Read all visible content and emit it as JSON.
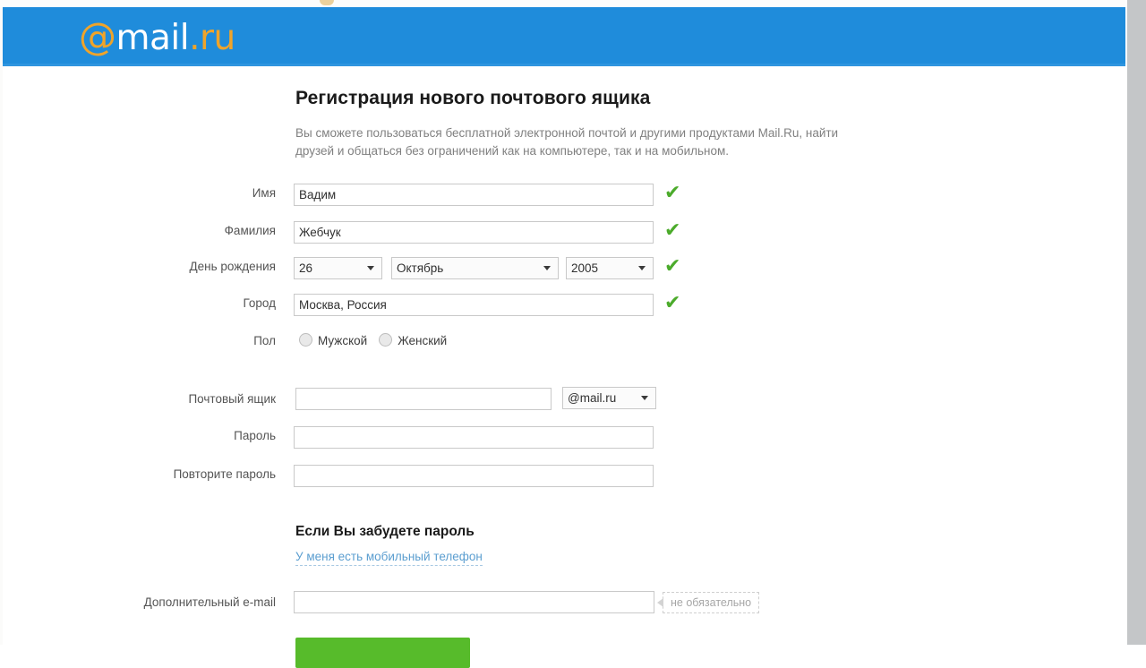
{
  "brand": {
    "at": "@",
    "mail": "mail",
    "dotru": ".ru",
    "header_color": "#1f8cdb",
    "accent_orange": "#efa42a",
    "check_green": "#4bab2b",
    "button_green": "#57bb2b"
  },
  "page": {
    "title": "Регистрация нового почтового ящика",
    "subtitle": "Вы сможете пользоваться бесплатной электронной почтой и другими продуктами Mail.Ru, найти друзей и общаться без ограничений как на компьютере, так и на мобильном."
  },
  "form": {
    "first_name": {
      "label": "Имя",
      "value": "Вадим",
      "placeholder": "",
      "valid_icon": "✔"
    },
    "last_name": {
      "label": "Фамилия",
      "value": "Жебчук",
      "placeholder": "",
      "valid_icon": "✔"
    },
    "birthday": {
      "label": "День рождения",
      "day": "26",
      "month": "Октябрь",
      "year": "2005",
      "valid_icon": "✔"
    },
    "city": {
      "label": "Город",
      "value": "Москва, Россия",
      "placeholder": "",
      "valid_icon": "✔"
    },
    "gender": {
      "label": "Пол",
      "options": [
        "Мужской",
        "Женский"
      ],
      "selected": ""
    },
    "mailbox": {
      "label": "Почтовый ящик",
      "value": "",
      "placeholder": "",
      "domain": "@mail.ru"
    },
    "password": {
      "label": "Пароль",
      "value": "",
      "placeholder": ""
    },
    "password_repeat": {
      "label": "Повторите пароль",
      "value": "",
      "placeholder": ""
    },
    "recovery": {
      "heading": "Если Вы забудете пароль",
      "phone_link": "У меня есть мобильный телефон"
    },
    "extra_email": {
      "label": "Дополнительный e-mail",
      "value": "",
      "placeholder": "",
      "hint": "не обязательно"
    },
    "submit": {
      "label": ""
    }
  }
}
